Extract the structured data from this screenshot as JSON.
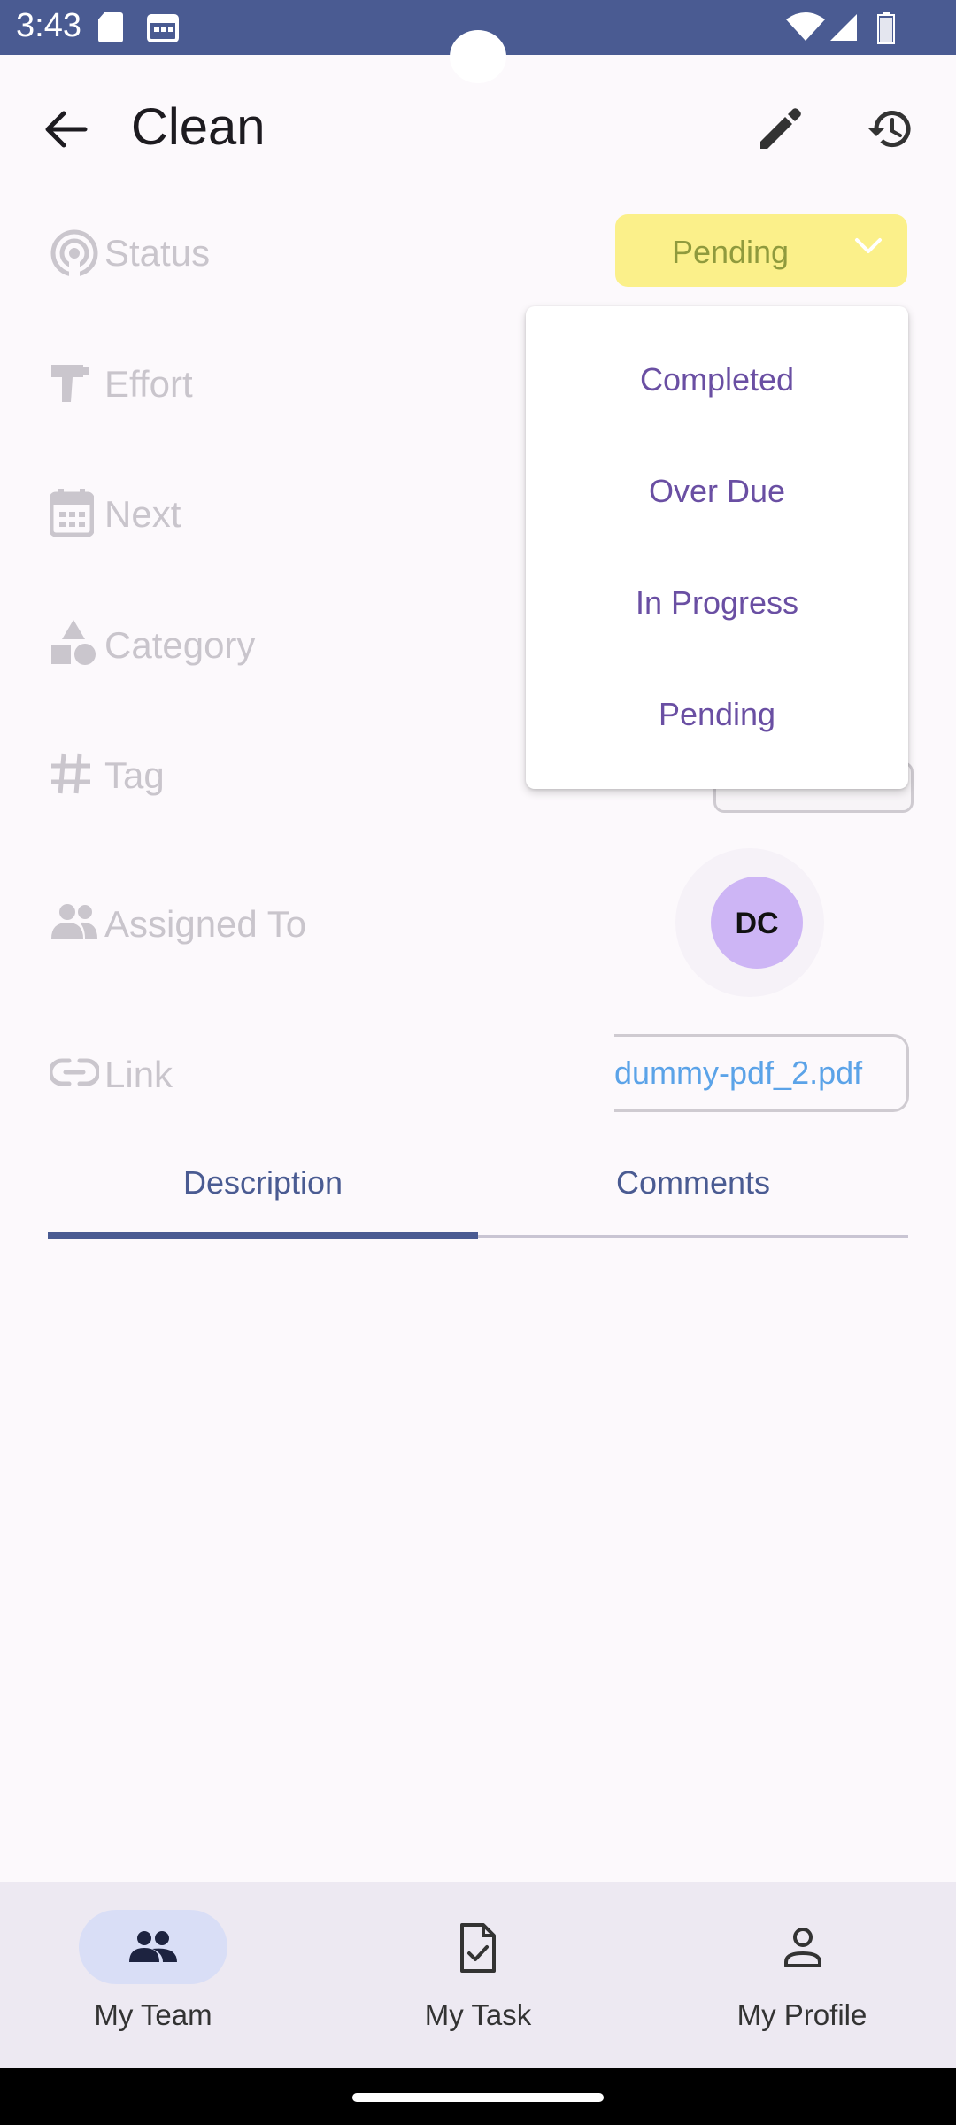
{
  "status_bar": {
    "time": "3:43"
  },
  "app_bar": {
    "title": "Clean"
  },
  "rows": {
    "status": "Status",
    "effort": "Effort",
    "next": "Next",
    "category": "Category",
    "tag": "Tag",
    "assigned_to": "Assigned To",
    "link": "Link"
  },
  "status_dropdown": {
    "selected": "Pending",
    "options": [
      "Completed",
      "Over Due",
      "In Progress",
      "Pending"
    ]
  },
  "assignee": {
    "initials": "DC"
  },
  "link_value": "dummy-pdf_2.pdf",
  "tabs": [
    {
      "label": "Description",
      "active": true
    },
    {
      "label": "Comments",
      "active": false
    }
  ],
  "bottom_nav": [
    {
      "label": "My Team",
      "icon": "group-icon",
      "active": true
    },
    {
      "label": "My Task",
      "icon": "task-doc-icon",
      "active": false
    },
    {
      "label": "My Profile",
      "icon": "person-icon",
      "active": false
    }
  ],
  "colors": {
    "primary": "#4a5b92",
    "status_pill_bg": "#fbf08a",
    "menu_text": "#6a4fa3",
    "avatar_bg": "#cdb5f5",
    "link_text": "#5ba3e8"
  }
}
